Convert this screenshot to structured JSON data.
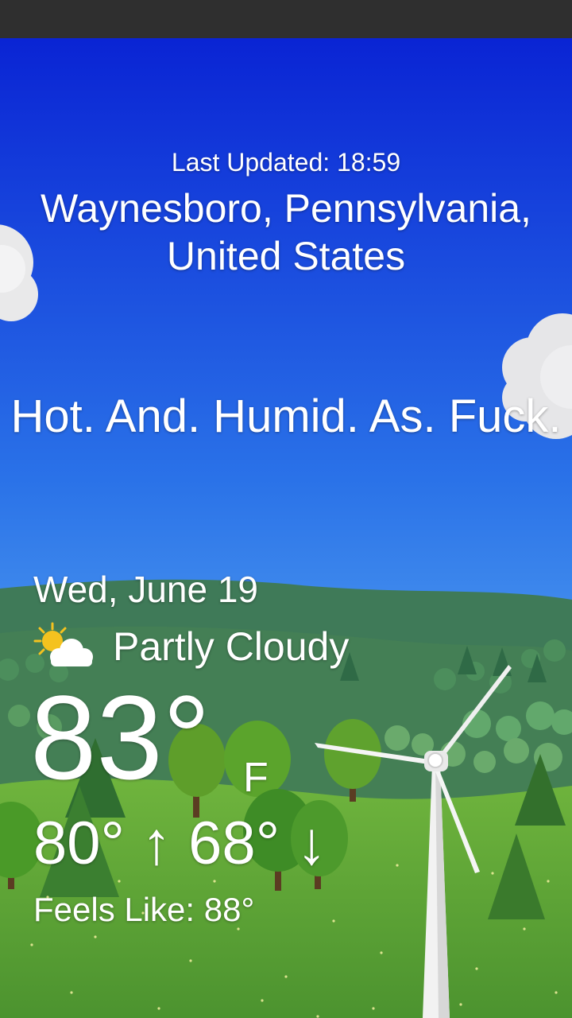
{
  "weather": {
    "last_updated": "Last Updated: 18:59",
    "location": "Waynesboro, Pennsylvania, United States",
    "message": "Hot. And. Humid. As. Fuck.",
    "date": "Wed, June 19",
    "condition": "Partly Cloudy",
    "condition_icon": "partly-cloudy-icon",
    "temperature": "83°",
    "unit": "F",
    "hi_lo": "80° ↑  68° ↓",
    "feels_like": "Feels Like: 88°"
  },
  "colors": {
    "sky_top": "#0a26d8",
    "sky_bottom": "#62b0f4",
    "hills": "#3e7a55",
    "grass": "#5aa03a",
    "status_bar": "#2f2f2f",
    "text": "#ffffff"
  }
}
